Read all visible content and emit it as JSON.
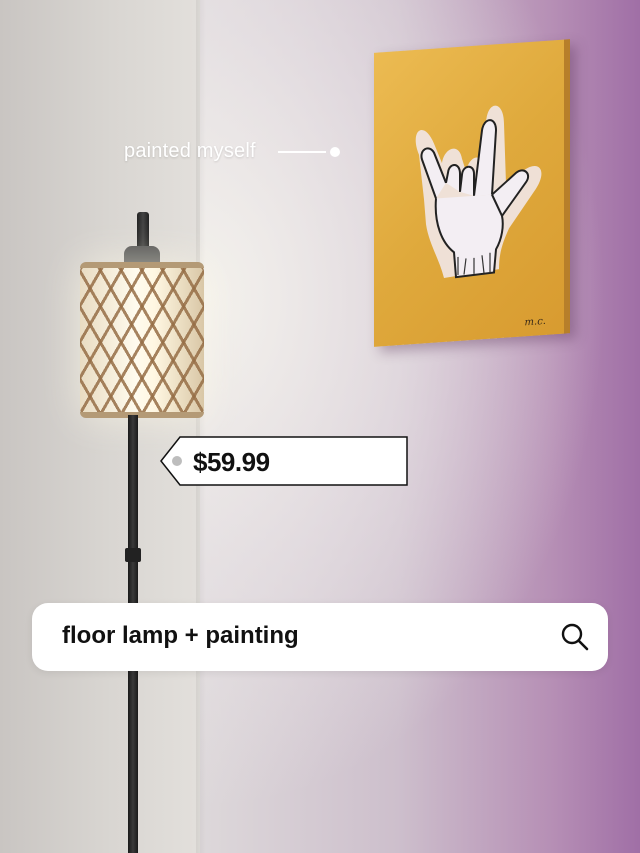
{
  "annotation": {
    "text": "painted myself"
  },
  "price_tag": {
    "price": "$59.99"
  },
  "search": {
    "query": "floor lamp + painting",
    "icon": "search-icon"
  },
  "painting": {
    "signature": "m.c."
  },
  "colors": {
    "wall_purple": "#a06fa6",
    "painting_yellow": "#e2aa3d",
    "search_bar_bg": "#ffffff",
    "text_dark": "#111111"
  }
}
